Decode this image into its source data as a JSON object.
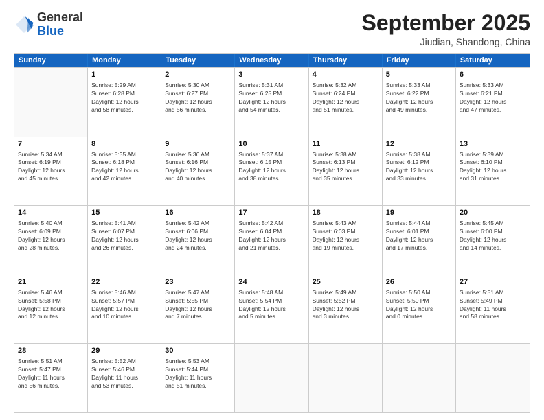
{
  "header": {
    "logo_general": "General",
    "logo_blue": "Blue",
    "month": "September 2025",
    "location": "Jiudian, Shandong, China"
  },
  "days_of_week": [
    "Sunday",
    "Monday",
    "Tuesday",
    "Wednesday",
    "Thursday",
    "Friday",
    "Saturday"
  ],
  "rows": [
    [
      {
        "day": "",
        "text": ""
      },
      {
        "day": "1",
        "text": "Sunrise: 5:29 AM\nSunset: 6:28 PM\nDaylight: 12 hours\nand 58 minutes."
      },
      {
        "day": "2",
        "text": "Sunrise: 5:30 AM\nSunset: 6:27 PM\nDaylight: 12 hours\nand 56 minutes."
      },
      {
        "day": "3",
        "text": "Sunrise: 5:31 AM\nSunset: 6:25 PM\nDaylight: 12 hours\nand 54 minutes."
      },
      {
        "day": "4",
        "text": "Sunrise: 5:32 AM\nSunset: 6:24 PM\nDaylight: 12 hours\nand 51 minutes."
      },
      {
        "day": "5",
        "text": "Sunrise: 5:33 AM\nSunset: 6:22 PM\nDaylight: 12 hours\nand 49 minutes."
      },
      {
        "day": "6",
        "text": "Sunrise: 5:33 AM\nSunset: 6:21 PM\nDaylight: 12 hours\nand 47 minutes."
      }
    ],
    [
      {
        "day": "7",
        "text": "Sunrise: 5:34 AM\nSunset: 6:19 PM\nDaylight: 12 hours\nand 45 minutes."
      },
      {
        "day": "8",
        "text": "Sunrise: 5:35 AM\nSunset: 6:18 PM\nDaylight: 12 hours\nand 42 minutes."
      },
      {
        "day": "9",
        "text": "Sunrise: 5:36 AM\nSunset: 6:16 PM\nDaylight: 12 hours\nand 40 minutes."
      },
      {
        "day": "10",
        "text": "Sunrise: 5:37 AM\nSunset: 6:15 PM\nDaylight: 12 hours\nand 38 minutes."
      },
      {
        "day": "11",
        "text": "Sunrise: 5:38 AM\nSunset: 6:13 PM\nDaylight: 12 hours\nand 35 minutes."
      },
      {
        "day": "12",
        "text": "Sunrise: 5:38 AM\nSunset: 6:12 PM\nDaylight: 12 hours\nand 33 minutes."
      },
      {
        "day": "13",
        "text": "Sunrise: 5:39 AM\nSunset: 6:10 PM\nDaylight: 12 hours\nand 31 minutes."
      }
    ],
    [
      {
        "day": "14",
        "text": "Sunrise: 5:40 AM\nSunset: 6:09 PM\nDaylight: 12 hours\nand 28 minutes."
      },
      {
        "day": "15",
        "text": "Sunrise: 5:41 AM\nSunset: 6:07 PM\nDaylight: 12 hours\nand 26 minutes."
      },
      {
        "day": "16",
        "text": "Sunrise: 5:42 AM\nSunset: 6:06 PM\nDaylight: 12 hours\nand 24 minutes."
      },
      {
        "day": "17",
        "text": "Sunrise: 5:42 AM\nSunset: 6:04 PM\nDaylight: 12 hours\nand 21 minutes."
      },
      {
        "day": "18",
        "text": "Sunrise: 5:43 AM\nSunset: 6:03 PM\nDaylight: 12 hours\nand 19 minutes."
      },
      {
        "day": "19",
        "text": "Sunrise: 5:44 AM\nSunset: 6:01 PM\nDaylight: 12 hours\nand 17 minutes."
      },
      {
        "day": "20",
        "text": "Sunrise: 5:45 AM\nSunset: 6:00 PM\nDaylight: 12 hours\nand 14 minutes."
      }
    ],
    [
      {
        "day": "21",
        "text": "Sunrise: 5:46 AM\nSunset: 5:58 PM\nDaylight: 12 hours\nand 12 minutes."
      },
      {
        "day": "22",
        "text": "Sunrise: 5:46 AM\nSunset: 5:57 PM\nDaylight: 12 hours\nand 10 minutes."
      },
      {
        "day": "23",
        "text": "Sunrise: 5:47 AM\nSunset: 5:55 PM\nDaylight: 12 hours\nand 7 minutes."
      },
      {
        "day": "24",
        "text": "Sunrise: 5:48 AM\nSunset: 5:54 PM\nDaylight: 12 hours\nand 5 minutes."
      },
      {
        "day": "25",
        "text": "Sunrise: 5:49 AM\nSunset: 5:52 PM\nDaylight: 12 hours\nand 3 minutes."
      },
      {
        "day": "26",
        "text": "Sunrise: 5:50 AM\nSunset: 5:50 PM\nDaylight: 12 hours\nand 0 minutes."
      },
      {
        "day": "27",
        "text": "Sunrise: 5:51 AM\nSunset: 5:49 PM\nDaylight: 11 hours\nand 58 minutes."
      }
    ],
    [
      {
        "day": "28",
        "text": "Sunrise: 5:51 AM\nSunset: 5:47 PM\nDaylight: 11 hours\nand 56 minutes."
      },
      {
        "day": "29",
        "text": "Sunrise: 5:52 AM\nSunset: 5:46 PM\nDaylight: 11 hours\nand 53 minutes."
      },
      {
        "day": "30",
        "text": "Sunrise: 5:53 AM\nSunset: 5:44 PM\nDaylight: 11 hours\nand 51 minutes."
      },
      {
        "day": "",
        "text": ""
      },
      {
        "day": "",
        "text": ""
      },
      {
        "day": "",
        "text": ""
      },
      {
        "day": "",
        "text": ""
      }
    ]
  ]
}
